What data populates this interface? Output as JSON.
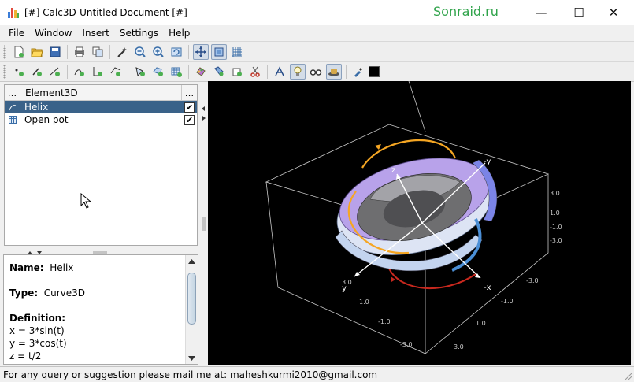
{
  "window": {
    "title": "[#] Calc3D-Untitled Document [#]",
    "watermark": "Sonraid.ru",
    "minimize_glyph": "—",
    "maximize_glyph": "☐",
    "close_glyph": "✕"
  },
  "menu": [
    "File",
    "Window",
    "Insert",
    "Settings",
    "Help"
  ],
  "toolbar1": [
    {
      "icon": "new-document-icon"
    },
    {
      "icon": "open-folder-icon"
    },
    {
      "icon": "save-icon"
    },
    {
      "icon": "print-icon"
    },
    {
      "icon": "copy-icon"
    },
    {
      "icon": "magic-wand-icon"
    },
    {
      "icon": "zoom-out-icon"
    },
    {
      "icon": "zoom-in-icon"
    },
    {
      "icon": "refresh-view-icon"
    },
    {
      "icon": "move-view-icon",
      "active": true
    },
    {
      "icon": "box-view-icon",
      "active": true
    },
    {
      "icon": "grid-axes-icon"
    }
  ],
  "toolbar2": [
    {
      "icon": "add-point-icon"
    },
    {
      "icon": "add-vector-icon"
    },
    {
      "icon": "add-line-icon"
    },
    {
      "icon": "add-curve-icon"
    },
    {
      "icon": "add-angle-icon"
    },
    {
      "icon": "add-plane-icon"
    },
    {
      "icon": "add-surface-icon"
    },
    {
      "icon": "add-polygon-icon"
    },
    {
      "icon": "add-grid-icon"
    },
    {
      "icon": "palette-icon"
    },
    {
      "icon": "brush-icon"
    },
    {
      "icon": "bucket-icon"
    },
    {
      "icon": "scissors-icon"
    },
    {
      "icon": "text-style-icon"
    },
    {
      "icon": "light-bulb-icon",
      "active": true
    },
    {
      "icon": "glasses-icon"
    },
    {
      "icon": "hat-icon",
      "active": true
    },
    {
      "icon": "color-picker-icon"
    }
  ],
  "tree": {
    "header_left": "...",
    "header_title": "Element3D",
    "header_right": "...",
    "rows": [
      {
        "label": "Helix",
        "selected": true,
        "checked": "✔",
        "icon": "curve-icon"
      },
      {
        "label": "Open pot",
        "selected": false,
        "checked": "✔",
        "icon": "surface-grid-icon"
      }
    ]
  },
  "properties": {
    "name_label": "Name:",
    "name_value": "Helix",
    "type_label": "Type:",
    "type_value": "Curve3D",
    "definition_label": "Definition:",
    "definition_lines": [
      "x = 3*sin(t)",
      "y = 3*cos(t)",
      "z = t/2"
    ]
  },
  "viewport": {
    "axis_labels": {
      "x_pos": "x",
      "x_neg": "-x",
      "y_pos": "y",
      "y_neg": "-y",
      "z_pos": "z"
    },
    "right_ticks": [
      "3.0",
      "1.0",
      "-1.0",
      "-3.0"
    ],
    "bottom_right_ticks": [
      "-3.0",
      "-1.0",
      "1.0",
      "3.0"
    ],
    "bottom_left_ticks": [
      "3.0",
      "1.0",
      "-1.0",
      "-3.0"
    ],
    "colors": {
      "background": "#000000",
      "surface_light": "#e6ecf8",
      "surface_purple": "#b8a2ea",
      "helix_orange": "#f5a623",
      "helix_red": "#c8281e",
      "axes": "#ffffff"
    }
  },
  "status": "For any query or suggestion please mail me at: maheshkurmi2010@gmail.com"
}
